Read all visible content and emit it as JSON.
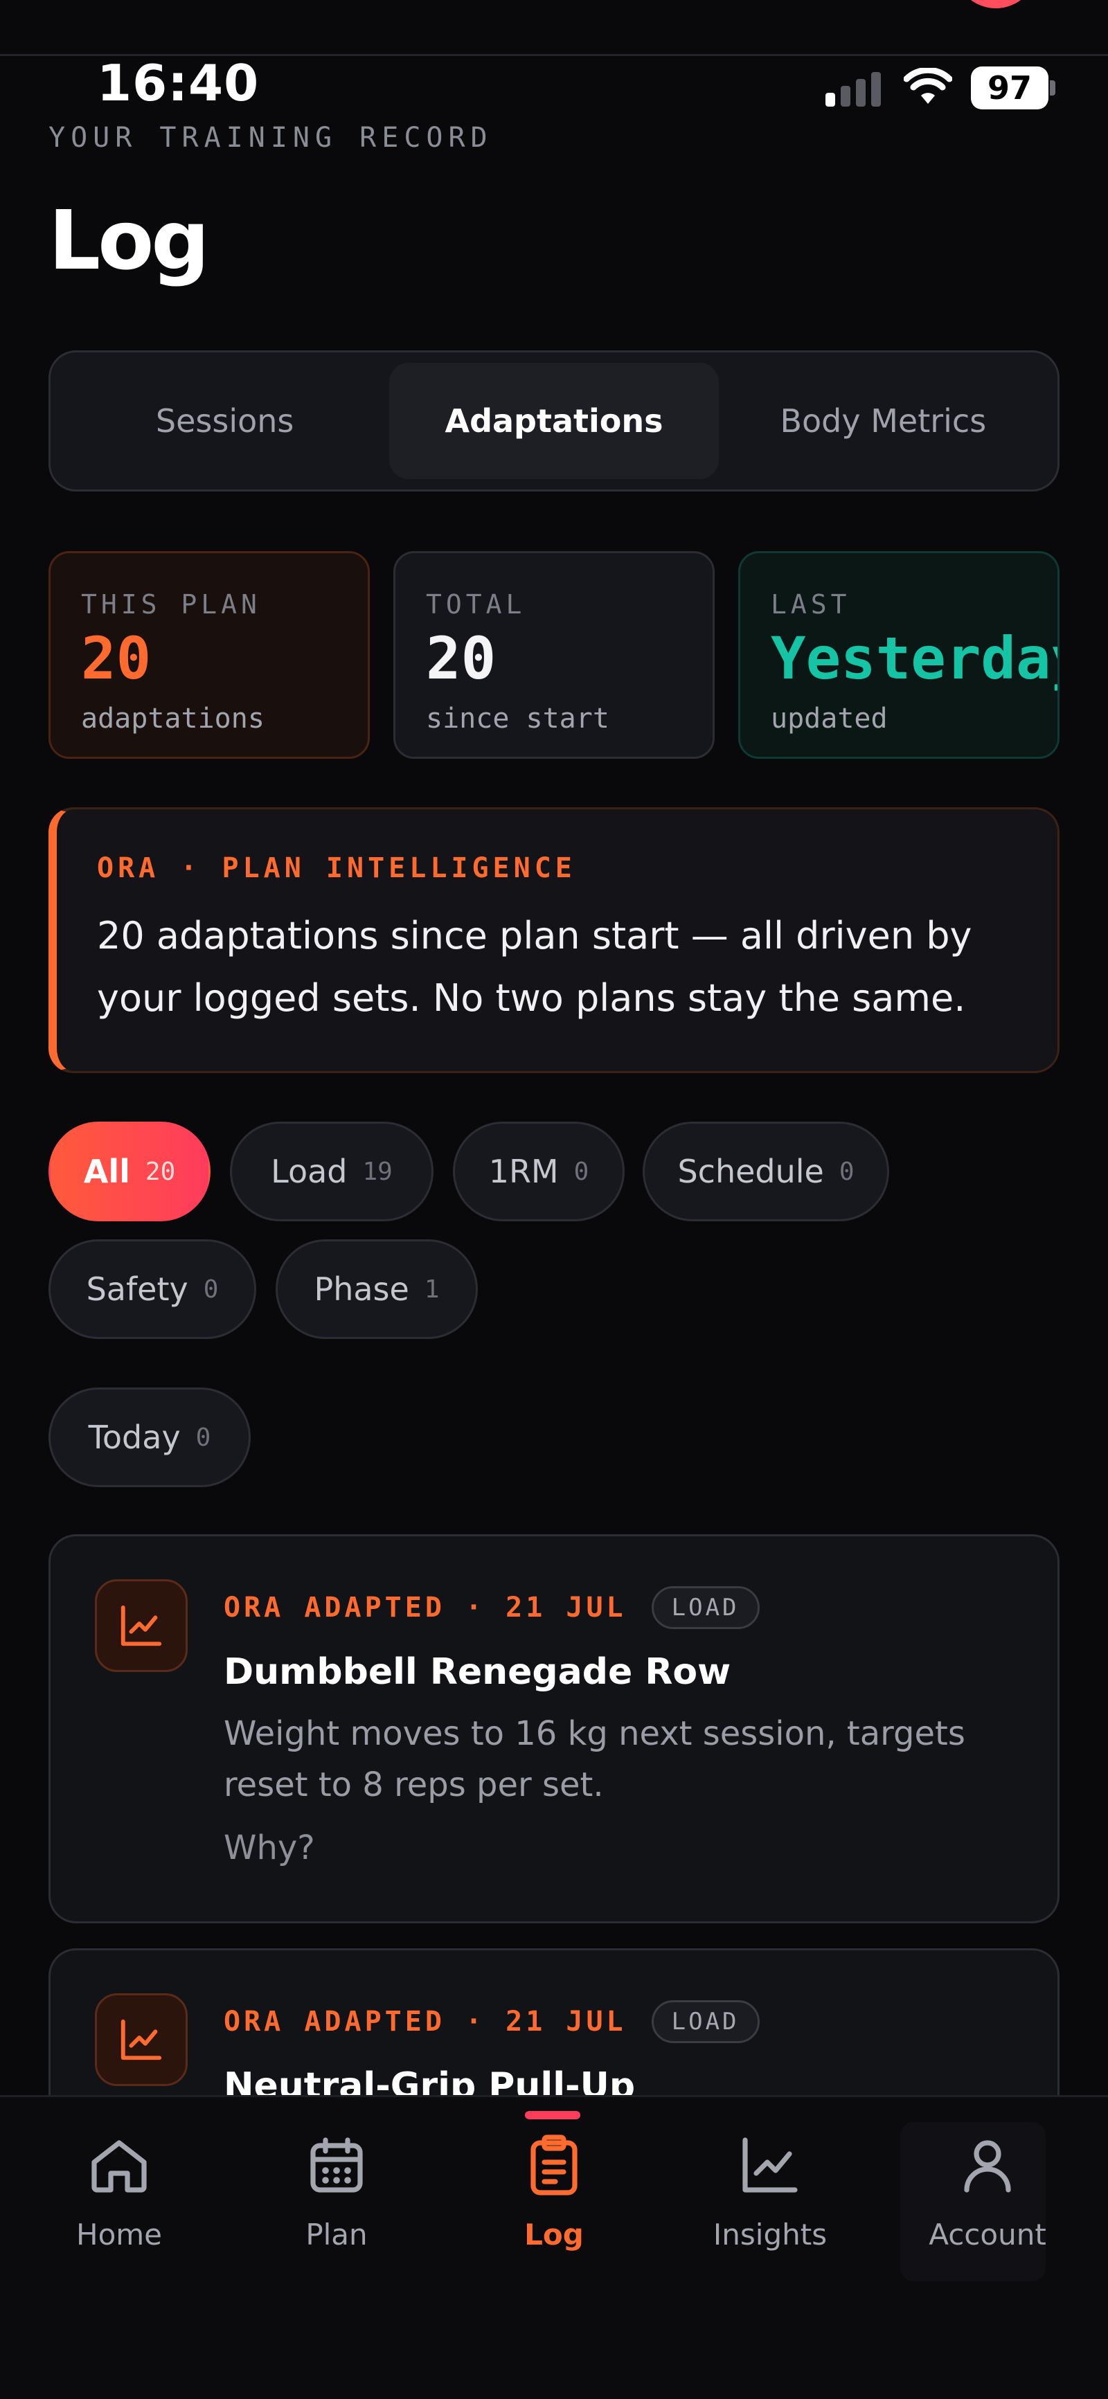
{
  "status_bar": {
    "time": "16:40",
    "battery": "97"
  },
  "header": {
    "overline": "YOUR TRAINING RECORD",
    "title": "Log"
  },
  "tabs": [
    {
      "label": "Sessions",
      "active": false
    },
    {
      "label": "Adaptations",
      "active": true
    },
    {
      "label": "Body Metrics",
      "active": false
    }
  ],
  "stats": [
    {
      "label": "THIS PLAN",
      "value": "20",
      "sub": "adaptations",
      "accent": "#ff6a2e"
    },
    {
      "label": "TOTAL",
      "value": "20",
      "sub": "since start",
      "accent": "#ffffff"
    },
    {
      "label": "LAST",
      "value": "Yesterday",
      "sub": "updated",
      "accent": "#15c4a4"
    }
  ],
  "banner": {
    "tag": "ORA · PLAN INTELLIGENCE",
    "message": "20 adaptations since plan start — all driven by your logged sets. No two plans stay the same."
  },
  "filters": [
    {
      "label": "All",
      "count": "20",
      "active": true
    },
    {
      "label": "Load",
      "count": "19"
    },
    {
      "label": "1RM",
      "count": "0"
    },
    {
      "label": "Schedule",
      "count": "0"
    },
    {
      "label": "Safety",
      "count": "0"
    },
    {
      "label": "Phase",
      "count": "1"
    },
    {
      "label": "Today",
      "count": "0"
    }
  ],
  "adaptations": [
    {
      "meta": "ORA ADAPTED · 21 JUL",
      "type": "LOAD",
      "title": "Dumbbell Renegade Row",
      "description": "Weight moves to 16 kg next session, targets reset to 8 reps per set.",
      "why": "Why?",
      "icon": "trend-chart-icon"
    },
    {
      "meta": "ORA ADAPTED · 21 JUL",
      "type": "LOAD",
      "title": "Neutral-Grip Pull-Up",
      "icon": "trend-chart-icon"
    }
  ],
  "nav": [
    {
      "label": "Home",
      "icon": "home-icon"
    },
    {
      "label": "Plan",
      "icon": "calendar-icon"
    },
    {
      "label": "Log",
      "icon": "clipboard-icon",
      "active": true
    },
    {
      "label": "Insights",
      "icon": "chart-icon"
    },
    {
      "label": "Account",
      "icon": "user-icon"
    }
  ],
  "colors": {
    "accent": "#ff6a2e",
    "teal": "#15c4a4",
    "background": "#09090b"
  }
}
